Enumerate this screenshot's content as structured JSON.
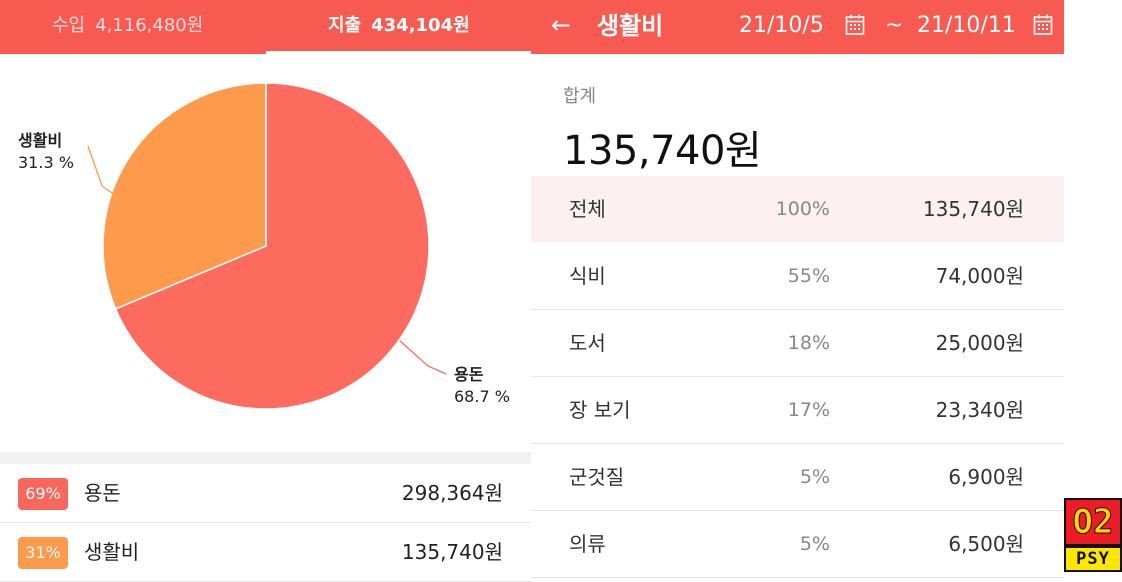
{
  "left": {
    "header": {
      "income_label": "수입",
      "income_amount": "4,116,480원",
      "expense_label": "지출",
      "expense_amount": "434,104원"
    },
    "pie_labels": [
      {
        "name": "생활비",
        "percent": "31.3 %"
      },
      {
        "name": "용돈",
        "percent": "68.7 %"
      }
    ],
    "list": [
      {
        "badge": "69%",
        "name": "용돈",
        "value": "298,364원",
        "color": "#f8675c"
      },
      {
        "badge": "31%",
        "name": "생활비",
        "value": "135,740원",
        "color": "#fd9a4c"
      }
    ]
  },
  "chart_data": {
    "type": "pie",
    "slices": [
      {
        "name": "용돈",
        "value": 68.7,
        "color": "#fd6b5f"
      },
      {
        "name": "생활비",
        "value": 31.3,
        "color": "#fd9a4c"
      }
    ]
  },
  "right": {
    "header": {
      "back_icon": "arrow-left-icon",
      "title": "생활비",
      "start_date": "21/10/5",
      "separator": "~",
      "end_date": "21/10/11"
    },
    "summary": {
      "label": "합계",
      "value": "135,740원"
    },
    "rows": [
      {
        "name": "전체",
        "percent": "100%",
        "value": "135,740원"
      },
      {
        "name": "식비",
        "percent": "55%",
        "value": "74,000원"
      },
      {
        "name": "도서",
        "percent": "18%",
        "value": "25,000원"
      },
      {
        "name": "장 보기",
        "percent": "17%",
        "value": "23,340원"
      },
      {
        "name": "군것질",
        "percent": "5%",
        "value": "6,900원"
      },
      {
        "name": "의류",
        "percent": "5%",
        "value": "6,500원"
      }
    ]
  },
  "watermark": {
    "top": "O2",
    "bottom": "PSY"
  },
  "colors": {
    "header": "#f65a50",
    "highlight_row": "#fdf0f0"
  }
}
